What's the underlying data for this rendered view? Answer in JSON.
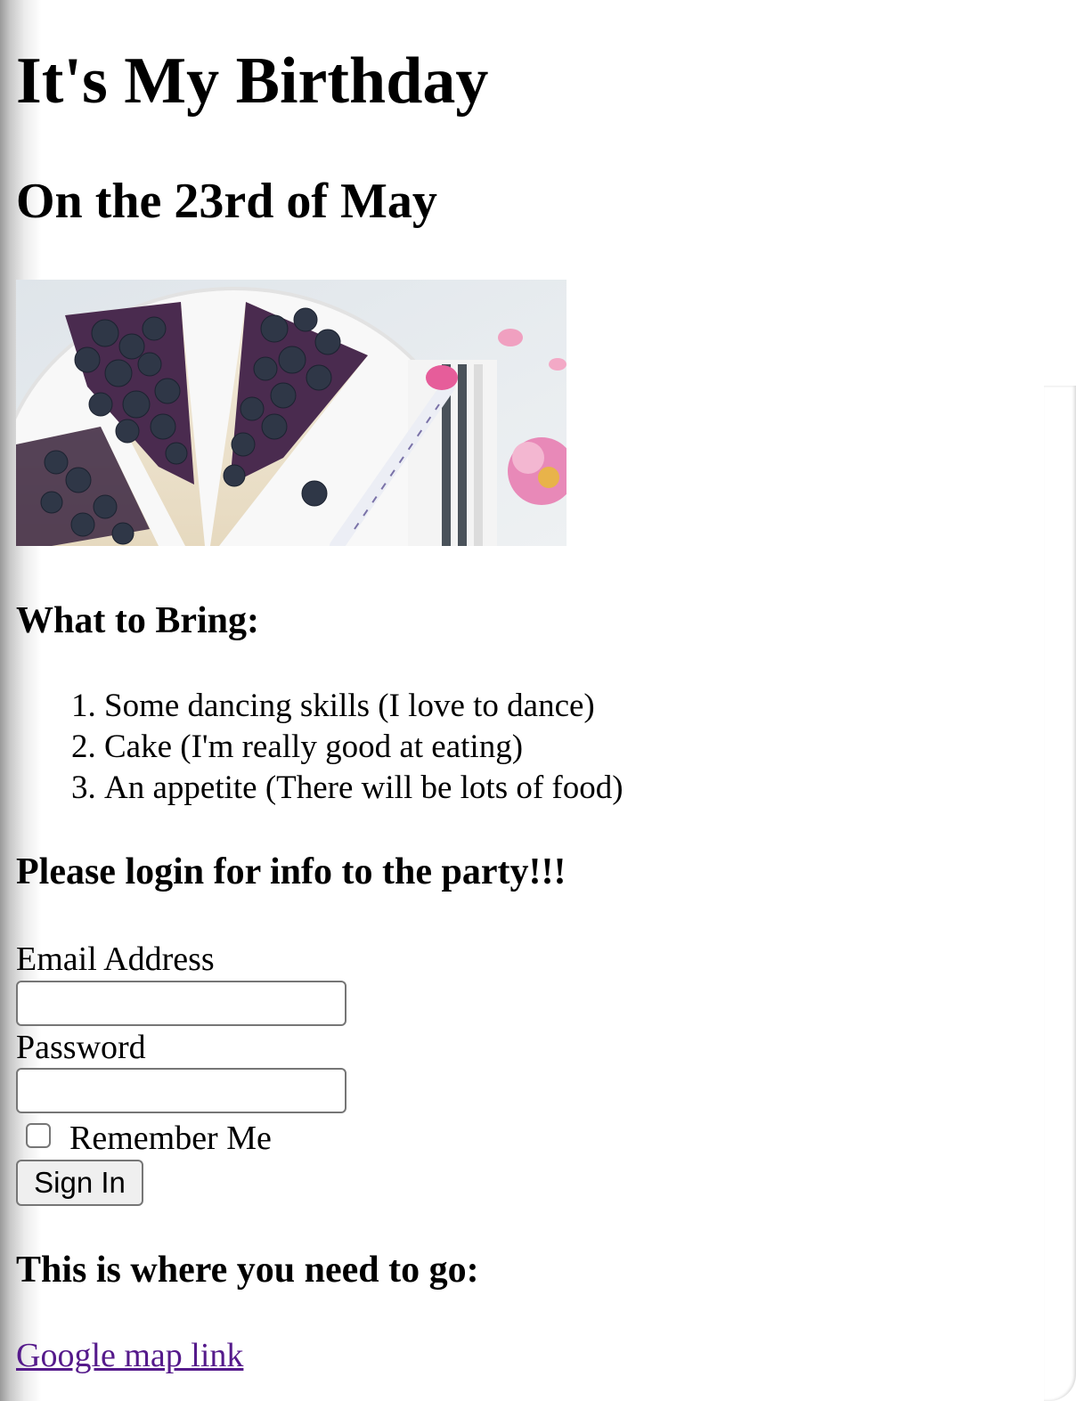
{
  "header": {
    "title": "It's My Birthday",
    "date": "On the 23rd of May"
  },
  "hero_image": {
    "icon": "blueberry-cheesecake-photo"
  },
  "bring": {
    "title": "What to Bring:",
    "items": [
      "Some dancing skills (I love to dance)",
      "Cake (I'm really good at eating)",
      "An appetite (There will be lots of food)"
    ]
  },
  "login": {
    "title": "Please login for info to the party!!!",
    "email_label": "Email Address",
    "email_value": "",
    "password_label": "Password",
    "password_value": "",
    "remember_label": "Remember Me",
    "remember_checked": false,
    "signin_label": "Sign In"
  },
  "location": {
    "title": "This is where you need to go:",
    "link_text": "Google map link"
  },
  "colors": {
    "link_visited": "#551a8b",
    "input_border": "#767676",
    "button_bg": "#efefef"
  }
}
